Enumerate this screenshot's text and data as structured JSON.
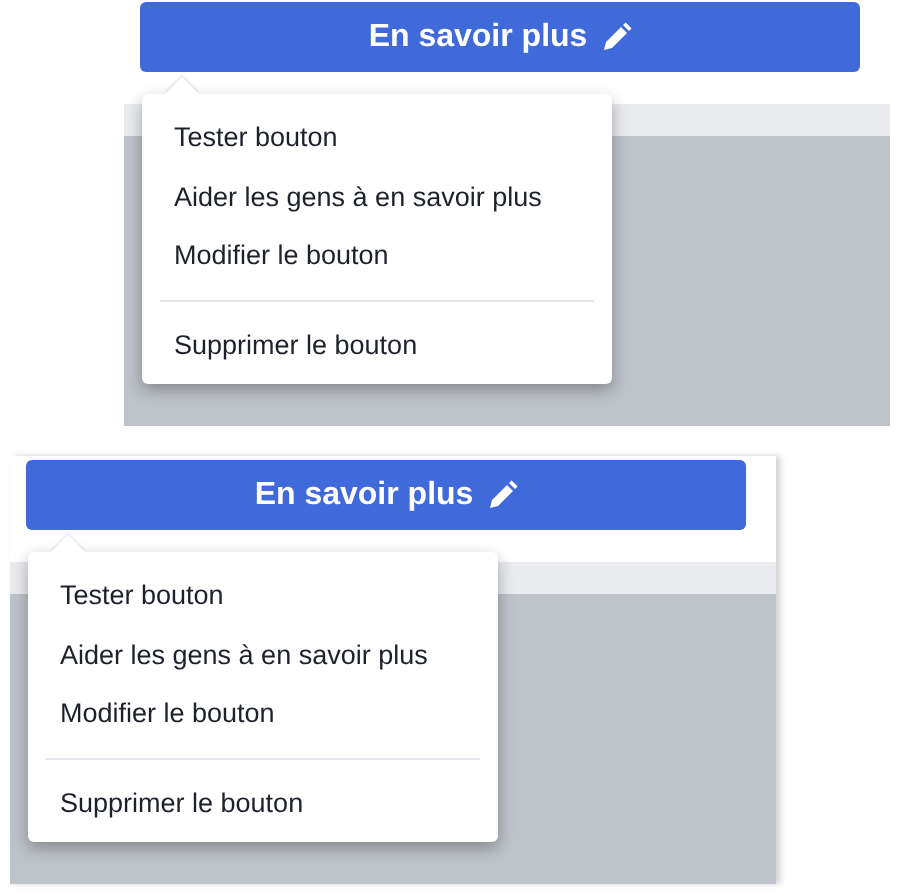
{
  "panels": [
    {
      "button": {
        "label": "En savoir plus"
      },
      "menu": {
        "groups": [
          [
            "Tester bouton",
            "Aider les gens à en savoir plus",
            "Modifier le bouton"
          ],
          [
            "Supprimer le bouton"
          ]
        ]
      }
    },
    {
      "button": {
        "label": "En savoir plus"
      },
      "menu": {
        "groups": [
          [
            "Tester bouton",
            "Aider les gens à en savoir plus",
            "Modifier le bouton"
          ],
          [
            "Supprimer le bouton"
          ]
        ]
      }
    }
  ]
}
